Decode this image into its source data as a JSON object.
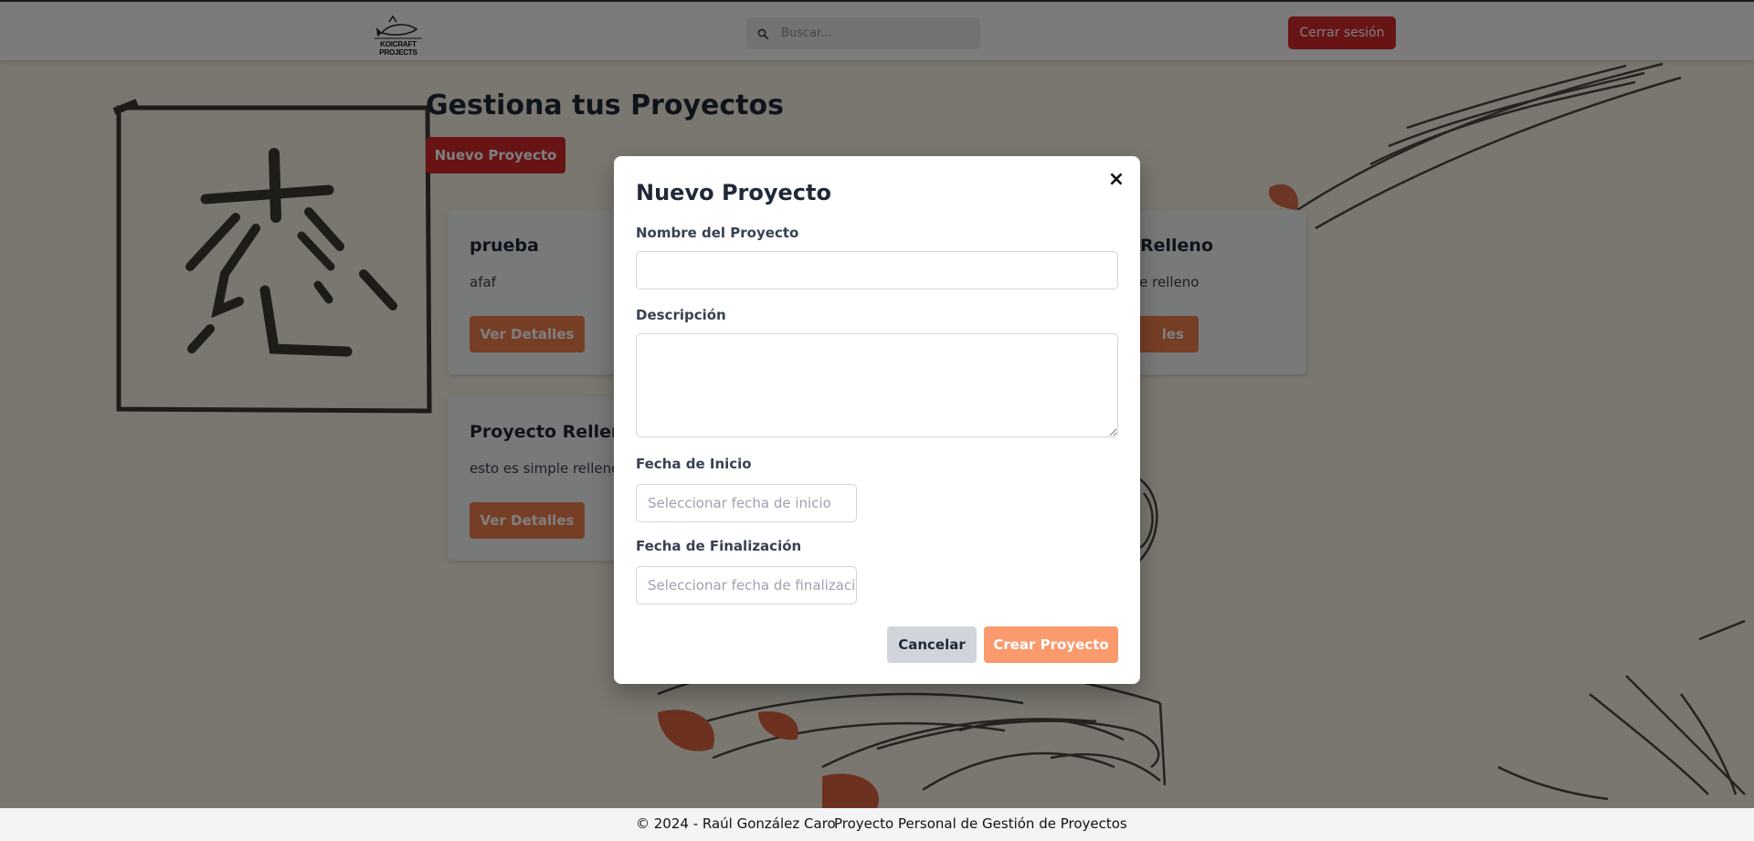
{
  "header": {
    "logo_text": "KOICRAFT PROJECTS",
    "search_placeholder": "Buscar...",
    "logout_label": "Cerrar sesión"
  },
  "main": {
    "title": "Gestiona tus Proyectos",
    "new_project_label": "Nuevo Proyecto",
    "projects": [
      {
        "title": "prueba",
        "description": "afaf",
        "details_label": "Ver Detalles"
      },
      {
        "title": "Proyecto Relleno",
        "description": "esto es simple relleno",
        "details_label": "Ver Detalles"
      },
      {
        "title": "Relleno",
        "description": "le relleno",
        "details_label": "les"
      }
    ]
  },
  "modal": {
    "title": "Nuevo Proyecto",
    "close_label": "×",
    "name_label": "Nombre del Proyecto",
    "name_value": "",
    "description_label": "Descripción",
    "description_value": "",
    "start_label": "Fecha de Inicio",
    "start_placeholder": "Seleccionar fecha de inicio",
    "end_label": "Fecha de Finalización",
    "end_placeholder": "Seleccionar fecha de finalización",
    "cancel_label": "Cancelar",
    "create_label": "Crear Proyecto"
  },
  "footer": {
    "copyright": "© 2024 - Raúl González Caro",
    "description": "Proyecto Personal de Gestión de Proyectos"
  },
  "colors": {
    "danger": "#d0282b",
    "accent": "#ee7d4d",
    "accent_light": "#fa9a6d",
    "neutral_button": "#d1d5db"
  }
}
